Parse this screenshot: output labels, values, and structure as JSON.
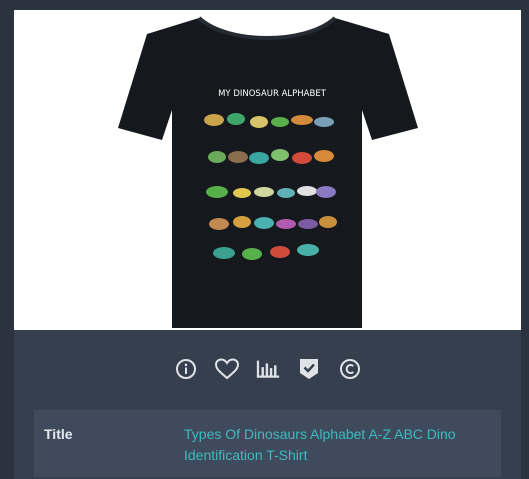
{
  "product": {
    "image_alt": "Black dinosaur alphabet t-shirt",
    "shirt_heading": "MY DINOSAUR ALPHABET"
  },
  "actions": [
    {
      "name": "info-icon"
    },
    {
      "name": "heart-icon"
    },
    {
      "name": "bar-chart-icon"
    },
    {
      "name": "verified-badge-icon"
    },
    {
      "name": "copyright-icon"
    }
  ],
  "details": {
    "title_label": "Title",
    "title_value": "Types Of Dinosaurs Alphabet A-Z ABC Dino Identification T-Shirt"
  },
  "colors": {
    "background": "#2b3240",
    "card": "#353f4e",
    "detail_panel": "#3f4b5d",
    "link": "#3fb9bf",
    "icon": "#dfe3e8"
  }
}
